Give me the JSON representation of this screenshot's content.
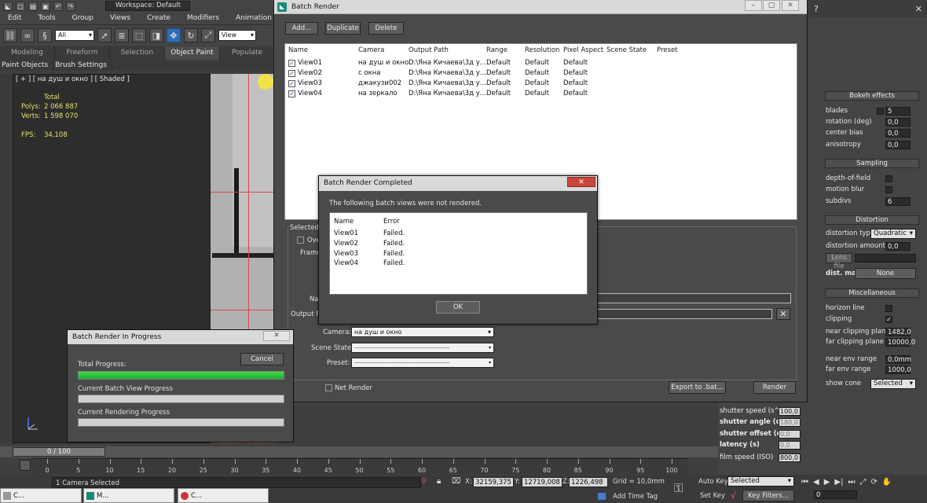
{
  "workspace": "Workspace: Default",
  "menus": [
    "Edit",
    "Tools",
    "Group",
    "Views",
    "Create",
    "Modifiers",
    "Animation",
    "G"
  ],
  "toolbar": {
    "selection_filter": "All",
    "ref_coord": "View"
  },
  "ribbon": {
    "tabs": [
      "Modeling",
      "Freeform",
      "Selection",
      "Object Paint",
      "Populate"
    ],
    "active": "Object Paint",
    "subtabs": [
      "Paint Objects",
      "Brush Settings"
    ]
  },
  "viewport": {
    "label": "[ + ] [ на душ и окно ] [ Shaded ]",
    "stats": {
      "total_label": "Total",
      "polys_label": "Polys:",
      "polys": "2 066 887",
      "verts_label": "Verts:",
      "verts": "1 598 070",
      "fps_label": "FPS:",
      "fps": "34,108"
    }
  },
  "batch_render": {
    "title": "Batch Render",
    "buttons": {
      "add": "Add...",
      "duplicate": "Duplicate",
      "delete": "Delete"
    },
    "columns": [
      "Name",
      "Camera",
      "Output Path",
      "Range",
      "Resolution",
      "Pixel Aspect",
      "Scene State",
      "Preset"
    ],
    "rows": [
      {
        "name": "View01",
        "camera": "на душ и окно",
        "path": "D:\\Яна Кичаева\\3д у...",
        "range": "Default",
        "resolution": "Default",
        "aspect": "Default"
      },
      {
        "name": "View02",
        "camera": "с окна",
        "path": "D:\\Яна Кичаева\\3д у...",
        "range": "Default",
        "resolution": "Default",
        "aspect": "Default"
      },
      {
        "name": "View03",
        "camera": "джакузи002",
        "path": "D:\\Яна Кичаева\\3д у...",
        "range": "Default",
        "resolution": "Default",
        "aspect": "Default"
      },
      {
        "name": "View04",
        "camera": "на зеркало",
        "path": "D:\\Яна Кичаева\\3д у...",
        "range": "Default",
        "resolution": "Default",
        "aspect": "Default"
      }
    ],
    "selected_group": "Selected B",
    "override": "Ove",
    "frames": "Frame",
    "name_label": "Na",
    "output_path_label": "Output Pa",
    "camera_label": "Camera:",
    "camera_value": "на душ и окно",
    "scene_state_label": "Scene State:",
    "scene_state_value": "--------------------------------------------------------",
    "preset_label": "Preset:",
    "preset_value": "--------------------------------------------------------",
    "net_render": "Net Render",
    "export": "Export to .bat...",
    "render": "Render"
  },
  "completed": {
    "title": "Batch Render Completed",
    "message": "The following batch views were not rendered.",
    "columns": [
      "Name",
      "Error"
    ],
    "rows": [
      {
        "name": "View01",
        "error": "Failed."
      },
      {
        "name": "View02",
        "error": "Failed."
      },
      {
        "name": "View03",
        "error": "Failed."
      },
      {
        "name": "View04",
        "error": "Failed."
      }
    ],
    "ok": "OK"
  },
  "progress": {
    "title": "Batch Render In Progress",
    "cancel": "Cancel",
    "total_label": "Total Progress:",
    "total": 1.0,
    "batch_label": "Current Batch View Progress",
    "batch": 0,
    "rendering_label": "Current Rendering Progress",
    "rendering": 0
  },
  "vray": {
    "bokeh": {
      "title": "Bokeh effects",
      "blades_label": "blades",
      "blades": "5",
      "rotation_label": "rotation (deg)",
      "rotation": "0,0",
      "center_bias_label": "center bias",
      "center_bias": "0,0",
      "anisotropy_label": "anisotropy",
      "anisotropy": "0,0"
    },
    "sampling": {
      "title": "Sampling",
      "dof_label": "depth-of-field",
      "motion_blur_label": "motion blur",
      "subdivs_label": "subdivs",
      "subdivs": "6"
    },
    "distortion": {
      "title": "Distortion",
      "type_label": "distortion type",
      "type": "Quadratic",
      "amount_label": "distortion amount",
      "amount": "0,0",
      "lens_file": "Lens file",
      "dist_map": "dist. map",
      "dist_map_value": "None"
    },
    "misc": {
      "title": "Miscellaneous",
      "horizon_label": "horizon line",
      "clipping_label": "clipping",
      "near_clip_label": "near clipping plane",
      "near_clip": "1482,0",
      "far_clip_label": "far clipping plane",
      "far_clip": "10000,0",
      "near_env_label": "near env range",
      "near_env": "0,0mm",
      "far_env_label": "far env range",
      "far_env": "1000,0",
      "show_cone_label": "show cone",
      "show_cone": "Selected"
    }
  },
  "camera_params": [
    {
      "label": "shutter speed (s^-1",
      "value": "100,0"
    },
    {
      "label": "shutter angle (deg)",
      "value": "180,0"
    },
    {
      "label": "shutter offset (deg)",
      "value": "0,0"
    },
    {
      "label": "latency (s)",
      "value": "0,0"
    },
    {
      "label": "film speed (ISO)",
      "value": "800,0"
    }
  ],
  "timeline": {
    "frame": "0 / 100",
    "ticks": [
      "0",
      "5",
      "10",
      "15",
      "20",
      "25",
      "30",
      "35",
      "40",
      "45",
      "50",
      "55",
      "60",
      "65",
      "70",
      "75",
      "80",
      "85",
      "90",
      "95",
      "100"
    ]
  },
  "status": {
    "message": "1 Camera Selected",
    "x_label": "X:",
    "x": "32159,375",
    "y_label": "Y:",
    "y": "12719,008",
    "z_label": "Z:",
    "z": "1226,498",
    "grid": "Grid = 10,0mm",
    "add_time_tag": "Add Time Tag",
    "auto_key": "Auto Key",
    "auto_key_value": "Selected",
    "set_key": "Set Key",
    "key_filters": "Key Filters...",
    "frame_field": "0"
  },
  "taskbar": [
    {
      "label": "C..."
    },
    {
      "label": "M..."
    },
    {
      "label": "C..."
    }
  ],
  "colors": {
    "progress": "#16b12b",
    "close": "#c9463d",
    "stats": "#e8e26a"
  }
}
